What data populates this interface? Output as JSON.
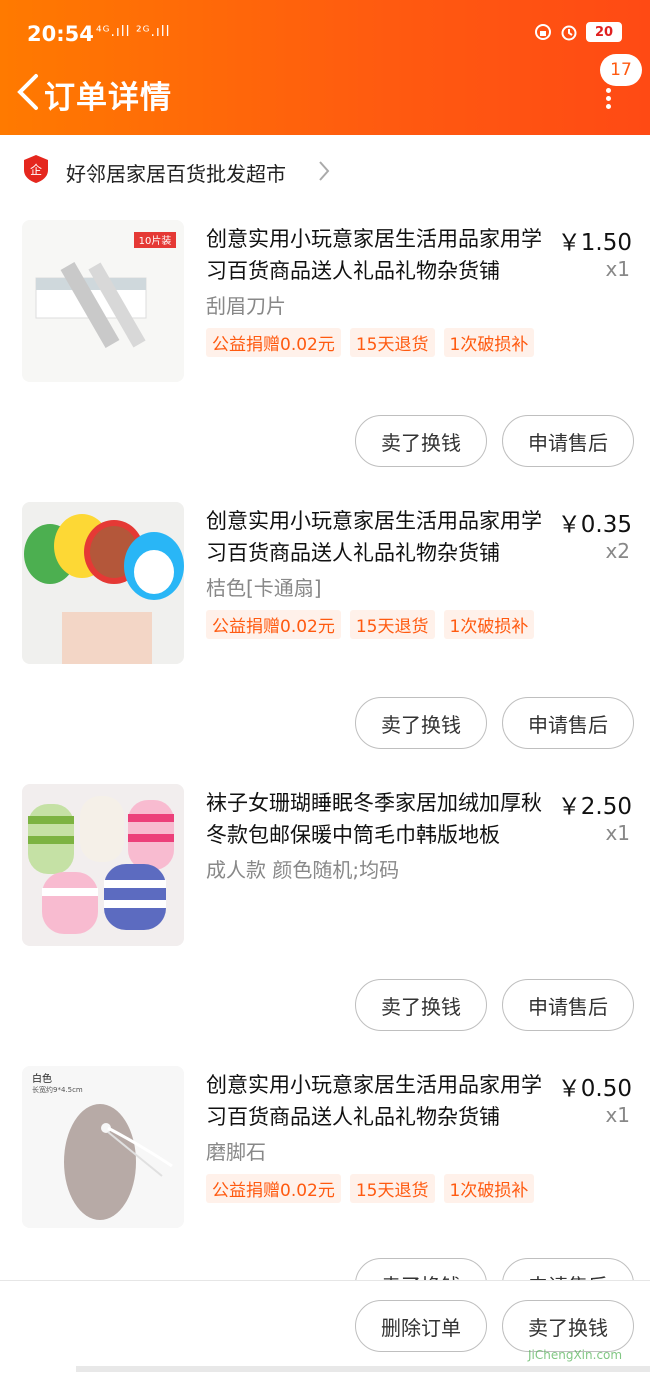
{
  "status_bar": {
    "time": "20:54",
    "signal": "⁴ᴳ.ıll ²ᴳ.ıll",
    "battery": "20"
  },
  "header": {
    "title": "订单详情",
    "badge_count": "17"
  },
  "store": {
    "name": "好邻居家居百货批发超市"
  },
  "items": [
    {
      "title": "创意实用小玩意家居生活用品家用学习百货商品送人礼品礼物杂货铺",
      "price": "￥1.50",
      "qty": "x1",
      "spec": "刮眉刀片",
      "tags": [
        "公益捐赠0.02元",
        "15天退货",
        "1次破损补"
      ],
      "thumb_label": "10片装"
    },
    {
      "title": "创意实用小玩意家居生活用品家用学习百货商品送人礼品礼物杂货铺",
      "price": "￥0.35",
      "qty": "x2",
      "spec": "桔色[卡通扇]",
      "tags": [
        "公益捐赠0.02元",
        "15天退货",
        "1次破损补"
      ]
    },
    {
      "title": "袜子女珊瑚睡眠冬季家居加绒加厚秋冬款包邮保暖中筒毛巾韩版地板",
      "price": "￥2.50",
      "qty": "x1",
      "spec": "成人款 颜色随机;均码",
      "tags": []
    },
    {
      "title": "创意实用小玩意家居生活用品家用学习百货商品送人礼品礼物杂货铺",
      "price": "￥0.50",
      "qty": "x1",
      "spec": "磨脚石",
      "tags": [
        "公益捐赠0.02元",
        "15天退货",
        "1次破损补"
      ],
      "thumb_label": "白色",
      "thumb_sublabel": "长宽约9*4.5cm"
    }
  ],
  "actions": {
    "sell": "卖了换钱",
    "after_sale": "申请售后",
    "delete": "删除订单"
  },
  "watermark": "JiChengXin.com",
  "colors": {
    "accent": "#ff5a10",
    "tag_bg": "#fff1ea"
  }
}
